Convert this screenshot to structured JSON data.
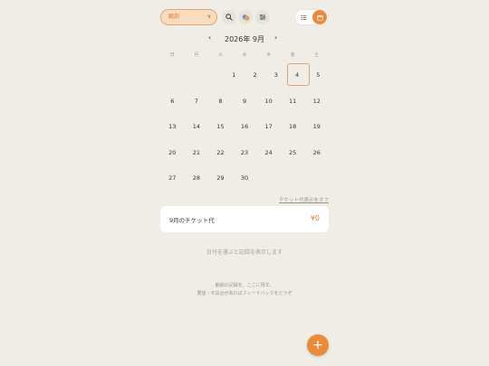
{
  "header": {
    "filter_value": "観劇",
    "view_list_icon": "list-icon",
    "view_calendar_icon": "calendar-icon"
  },
  "calendar": {
    "month_label": "2026年 9月",
    "prev": "‹",
    "next": "›",
    "weekdays": [
      "日",
      "月",
      "火",
      "水",
      "木",
      "金",
      "土"
    ],
    "weeks": [
      [
        "",
        "",
        "",
        "1",
        "2",
        "3",
        "4",
        "5"
      ],
      [
        "6",
        "7",
        "8",
        "9",
        "10",
        "11",
        "12"
      ],
      [
        "13",
        "14",
        "15",
        "16",
        "17",
        "18",
        "19"
      ],
      [
        "20",
        "21",
        "22",
        "23",
        "24",
        "25",
        "26"
      ],
      [
        "27",
        "28",
        "29",
        "30",
        "",
        "",
        ""
      ]
    ],
    "selected_day": "4"
  },
  "ticket": {
    "toggle_link": "チケット代表示をオフ",
    "label": "9月のチケット代",
    "amount": "¥0"
  },
  "hint": "日付を選ぶと記録を表示します",
  "footer": {
    "line1": "観劇の記録を、ここに残す。",
    "line2": "要望・不具合があればフィードバックをどうぞ"
  },
  "fab_label": "+",
  "colors": {
    "accent": "#e88b3c",
    "background": "#efede5"
  }
}
